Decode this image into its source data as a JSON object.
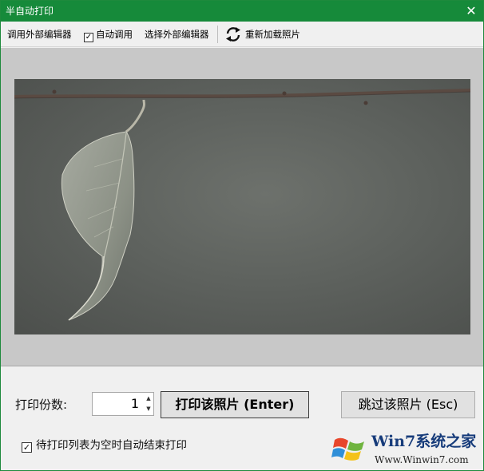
{
  "window": {
    "title": "半自动打印",
    "close_glyph": "✕",
    "accent_color": "#168a3a"
  },
  "toolbar": {
    "call_external_editor": "调用外部编辑器",
    "auto_call": {
      "label": "自动调用",
      "checked": true,
      "check_glyph": "✓"
    },
    "choose_external_editor": "选择外部编辑器",
    "reload_icon": "refresh-icon",
    "reload_photo": "重新加载照片"
  },
  "viewer": {
    "background_color": "#c8c8c8",
    "photo": "leaf hanging from a twig on a grey background"
  },
  "bottom": {
    "copies_label": "打印份数:",
    "copies_value": "1",
    "spin_up_glyph": "▲",
    "spin_down_glyph": "▼",
    "print_button": "打印该照片 (Enter)",
    "skip_button": "跳过该照片 (Esc)",
    "auto_end": {
      "label": "待打印列表为空时自动结束打印",
      "checked": true,
      "check_glyph": "✓"
    }
  },
  "watermark": {
    "name": "Win7系统之家",
    "url": "Www.Winwin7.com"
  }
}
